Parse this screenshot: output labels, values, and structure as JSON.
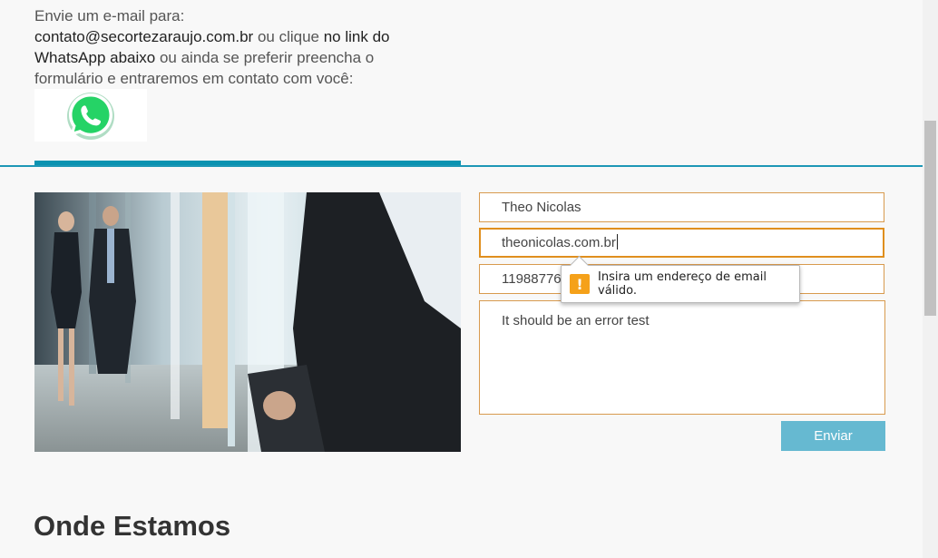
{
  "intro": {
    "line1": "Envie um e-mail para:",
    "email": "contato@secortezaraujo.com.br",
    "mid1": " ou clique ",
    "link": "no link do WhatsApp abaixo",
    "rest": " ou ainda se preferir preencha o formulário e entraremos em contato com você:"
  },
  "whatsapp": {
    "icon": "whatsapp-icon",
    "color": "#25d366"
  },
  "form": {
    "name_value": "Theo Nicolas",
    "email_value": "theonicolas.com.br",
    "phone_value": "11988776",
    "message_value": "It should be an error test",
    "submit_label": "Enviar"
  },
  "validation": {
    "message": "Insira um endereço de email válido.",
    "icon": "warning-icon",
    "icon_glyph": "!",
    "icon_color": "#f5a11a"
  },
  "section": {
    "title": "Onde Estamos"
  },
  "colors": {
    "accent": "#0b93b1",
    "field_border": "#d89a4e",
    "button": "#66b9d1"
  }
}
